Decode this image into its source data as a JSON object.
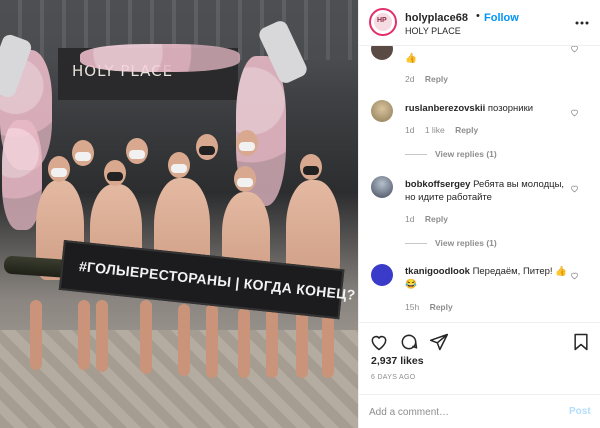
{
  "photo": {
    "sign_text": "HOLY PLACE",
    "banner_text": "#ГОЛЫЕРЕСТОРАНЫ | КОГДА КОНЕЦ?"
  },
  "header": {
    "username": "holyplace68",
    "separator": "•",
    "follow_label": "Follow",
    "location": "HOLY PLACE",
    "more_icon": "more-horizontal-icon"
  },
  "comments": [
    {
      "username": "",
      "text": "👍",
      "time": "2d",
      "likes": "",
      "reply_label": "Reply",
      "view_replies": ""
    },
    {
      "username": "ruslanberezovskii",
      "text": "позорники",
      "time": "1d",
      "likes": "1 like",
      "reply_label": "Reply",
      "view_replies": "View replies (1)"
    },
    {
      "username": "bobkoffsergey",
      "text": "Ребята вы молодцы, но идите работайте",
      "time": "1d",
      "likes": "",
      "reply_label": "Reply",
      "view_replies": "View replies (1)"
    },
    {
      "username": "tkanigoodlook",
      "text": "Передаём, Питер! 👍😂",
      "time": "15h",
      "likes": "",
      "reply_label": "Reply",
      "view_replies": ""
    }
  ],
  "actions": {
    "icons": [
      "heart-icon",
      "comment-icon",
      "share-icon",
      "bookmark-icon"
    ],
    "likes_count": "2,937 likes",
    "posted_ago": "6 DAYS AGO"
  },
  "add_comment": {
    "placeholder": "Add a comment…",
    "post_label": "Post"
  },
  "colors": {
    "accent": "#0095f6",
    "post_disabled": "#b2dffc",
    "muted": "#8e8e8e"
  }
}
